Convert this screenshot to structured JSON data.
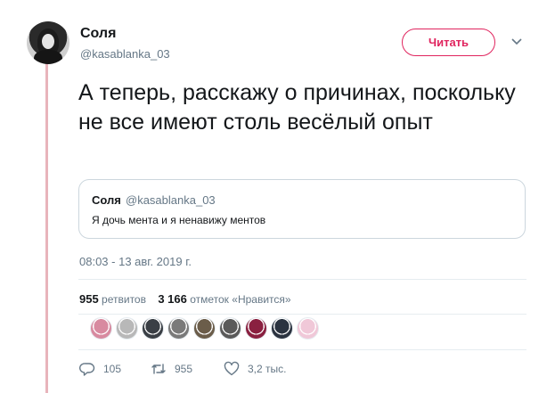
{
  "author": {
    "display_name": "Соля",
    "handle": "@kasablanka_03"
  },
  "follow_button": {
    "label": "Читать"
  },
  "tweet": {
    "text": "А теперь, расскажу о причинах, поскольку не все имеют столь весёлый опыт",
    "timestamp": "08:03 - 13 авг. 2019 г."
  },
  "quoted_tweet": {
    "display_name": "Соля",
    "handle": "@kasablanka_03",
    "text": "Я дочь мента и я ненавижу ментов"
  },
  "stats": {
    "retweets_count": "955",
    "retweets_label": "ретвитов",
    "likes_count": "3 166",
    "likes_label": "отметок «Нравится»"
  },
  "liked_by_avatar_colors": [
    "#d88aa0",
    "#b8b8b8",
    "#3a3f45",
    "#7a7a7a",
    "#6b5d4a",
    "#5a5a5a",
    "#8a2040",
    "#2b3340",
    "#f0c8d8"
  ],
  "actions": {
    "reply_count": "105",
    "retweet_count": "955",
    "like_count": "3,2 тыс."
  },
  "colors": {
    "accent": "#e0245e",
    "thread_line": "#e8b4bb",
    "secondary_text": "#657786"
  }
}
